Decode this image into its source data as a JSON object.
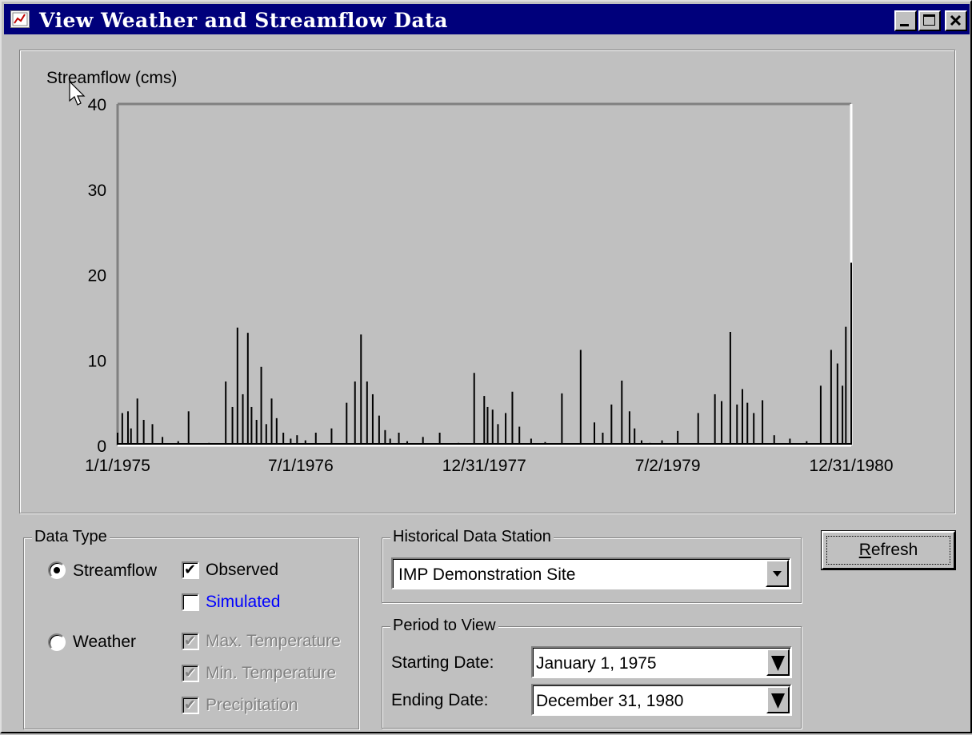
{
  "window": {
    "title": "View Weather and Streamflow Data",
    "controls": {
      "minimize": "minimize-icon",
      "maximize": "maximize-icon",
      "close": "close-icon"
    }
  },
  "chart_data": {
    "type": "line",
    "ylabel": "Streamflow (cms)",
    "ylim": [
      0,
      40
    ],
    "yticks": [
      "0",
      "10",
      "20",
      "30",
      "40"
    ],
    "xlim": [
      "1975-01-01",
      "1980-12-31"
    ],
    "xticks": [
      "1/1/1975",
      "7/1/1976",
      "12/31/1977",
      "7/2/1979",
      "12/31/1980"
    ],
    "xtick_dates": [
      "1975-01-01",
      "1976-07-01",
      "1977-12-31",
      "1979-07-02",
      "1980-12-31"
    ],
    "grid": false,
    "series": [
      {
        "color": "#000000",
        "x": [
          "1975-01-01",
          "1975-01-15",
          "1975-02-01",
          "1975-02-10",
          "1975-03-01",
          "1975-03-20",
          "1975-04-15",
          "1975-05-15",
          "1975-07-01",
          "1975-08-01",
          "1975-10-01",
          "1975-11-20",
          "1975-12-10",
          "1975-12-25",
          "1976-01-10",
          "1976-01-25",
          "1976-02-05",
          "1976-02-20",
          "1976-03-05",
          "1976-03-20",
          "1976-04-05",
          "1976-04-20",
          "1976-05-10",
          "1976-06-01",
          "1976-06-20",
          "1976-07-15",
          "1976-08-15",
          "1976-10-01",
          "1976-11-15",
          "1976-12-10",
          "1976-12-28",
          "1977-01-15",
          "1977-02-01",
          "1977-02-20",
          "1977-03-10",
          "1977-03-25",
          "1977-04-20",
          "1977-05-15",
          "1977-07-01",
          "1977-08-20",
          "1977-10-15",
          "1977-12-01",
          "1977-12-31",
          "1978-01-10",
          "1978-01-25",
          "1978-02-10",
          "1978-03-05",
          "1978-03-25",
          "1978-04-15",
          "1978-05-20",
          "1978-07-01",
          "1978-08-20",
          "1978-10-15",
          "1978-11-25",
          "1978-12-20",
          "1979-01-15",
          "1979-02-15",
          "1979-03-10",
          "1979-03-25",
          "1979-04-15",
          "1979-05-10",
          "1979-06-15",
          "1979-08-01",
          "1979-10-01",
          "1979-11-20",
          "1979-12-10",
          "1980-01-05",
          "1980-01-25",
          "1980-02-10",
          "1980-02-25",
          "1980-03-15",
          "1980-04-10",
          "1980-05-15",
          "1980-07-01",
          "1980-08-20",
          "1980-10-01",
          "1980-11-01",
          "1980-11-20",
          "1980-12-05",
          "1980-12-15",
          "1980-12-31"
        ],
        "y": [
          1.5,
          3.8,
          4.0,
          2.0,
          5.5,
          3.0,
          2.5,
          1.0,
          0.5,
          4.0,
          0.3,
          7.5,
          4.5,
          13.8,
          6.0,
          13.2,
          4.5,
          3.0,
          9.2,
          2.5,
          5.5,
          3.2,
          1.5,
          0.8,
          1.2,
          0.6,
          1.5,
          2.0,
          5.0,
          7.5,
          13.0,
          7.5,
          6.0,
          3.5,
          1.8,
          0.8,
          1.5,
          0.5,
          1.0,
          1.5,
          0.3,
          8.5,
          5.8,
          4.5,
          4.2,
          2.5,
          3.8,
          6.3,
          2.2,
          0.8,
          0.4,
          6.1,
          11.2,
          2.7,
          1.5,
          4.8,
          7.6,
          4.0,
          2.0,
          0.6,
          0.3,
          0.6,
          1.7,
          3.8,
          6.0,
          5.2,
          13.3,
          4.8,
          6.6,
          5.0,
          3.8,
          5.3,
          1.2,
          0.8,
          0.5,
          7.0,
          11.2,
          9.6,
          7.0,
          13.9,
          21.4
        ]
      }
    ]
  },
  "data_type": {
    "legend": "Data Type",
    "streamflow": "Streamflow",
    "weather": "Weather",
    "observed": "Observed",
    "simulated": "Simulated",
    "max_temp": "Max. Temperature",
    "min_temp": "Min. Temperature",
    "precip": "Precipitation",
    "simulated_color": "#0000ff"
  },
  "station": {
    "legend": "Historical Data Station",
    "value": "IMP Demonstration Site"
  },
  "period": {
    "legend": "Period to View",
    "start_label": "Starting Date:",
    "start_value": "January 1, 1975",
    "end_label": "Ending Date:",
    "end_value": "December 31, 1980"
  },
  "refresh_label": "Refresh"
}
